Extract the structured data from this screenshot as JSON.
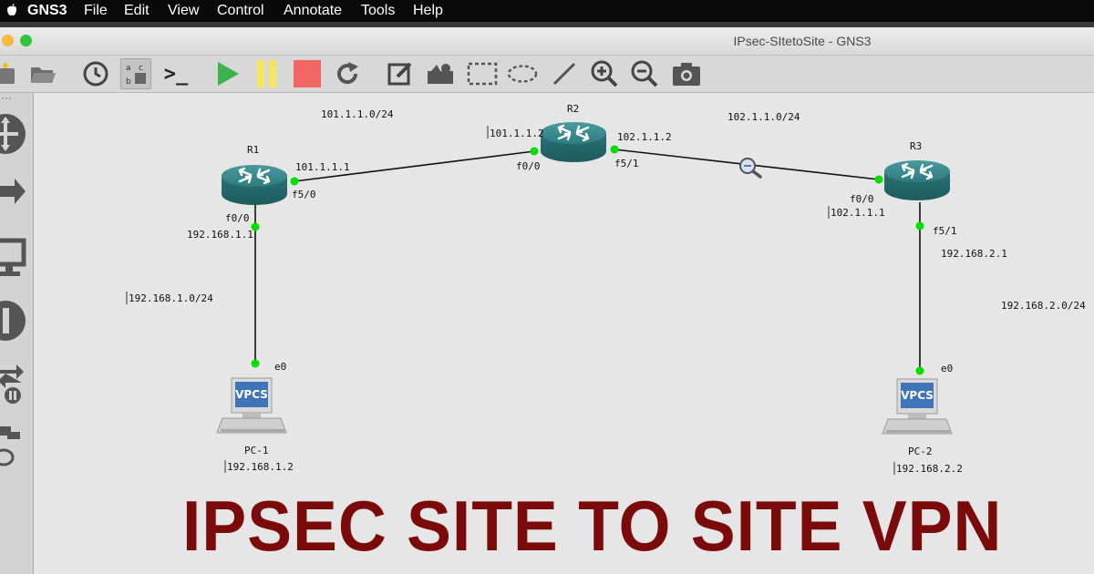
{
  "menubar": {
    "app_name": "GNS3",
    "items": [
      "File",
      "Edit",
      "View",
      "Control",
      "Annotate",
      "Tools",
      "Help"
    ]
  },
  "window": {
    "title": "IPsec-SItetoSite - GNS3"
  },
  "toolbar": {
    "snapshot_label": "a b c",
    "console_label": ">_",
    "colors": {
      "start": "#3cb34a",
      "pause": "#f7e45a",
      "stop": "#f26666"
    }
  },
  "topology": {
    "routers": [
      {
        "name": "R1",
        "interfaces": [
          "f0/0",
          "f5/0"
        ]
      },
      {
        "name": "R2",
        "interfaces": [
          "f0/0",
          "f5/1"
        ]
      },
      {
        "name": "R3",
        "interfaces": [
          "f0/0",
          "f5/1"
        ]
      }
    ],
    "hosts": [
      {
        "name": "PC-1",
        "interface": "e0",
        "ip": "192.168.1.2",
        "icon_text": "VPCS"
      },
      {
        "name": "PC-2",
        "interface": "e0",
        "ip": "192.168.2.2",
        "icon_text": "VPCS"
      }
    ],
    "labels": {
      "net_r1_r2": "101.1.1.0/24",
      "net_r2_r3": "102.1.1.0/24",
      "net_lan1": "192.168.1.0/24",
      "net_lan2": "192.168.2.0/24",
      "r1_f5_0_ip": "101.1.1.1",
      "r2_f0_0_ip": "101.1.1.2",
      "r2_f5_1_ip": "102.1.1.2",
      "r3_f0_0_ip": "102.1.1.1",
      "r1_f0_0_ip": "192.168.1.1",
      "r3_f5_1_ip": "192.168.2.1"
    },
    "link_status_color": "#00e000"
  },
  "headline": "IPSEC SITE TO SITE VPN"
}
